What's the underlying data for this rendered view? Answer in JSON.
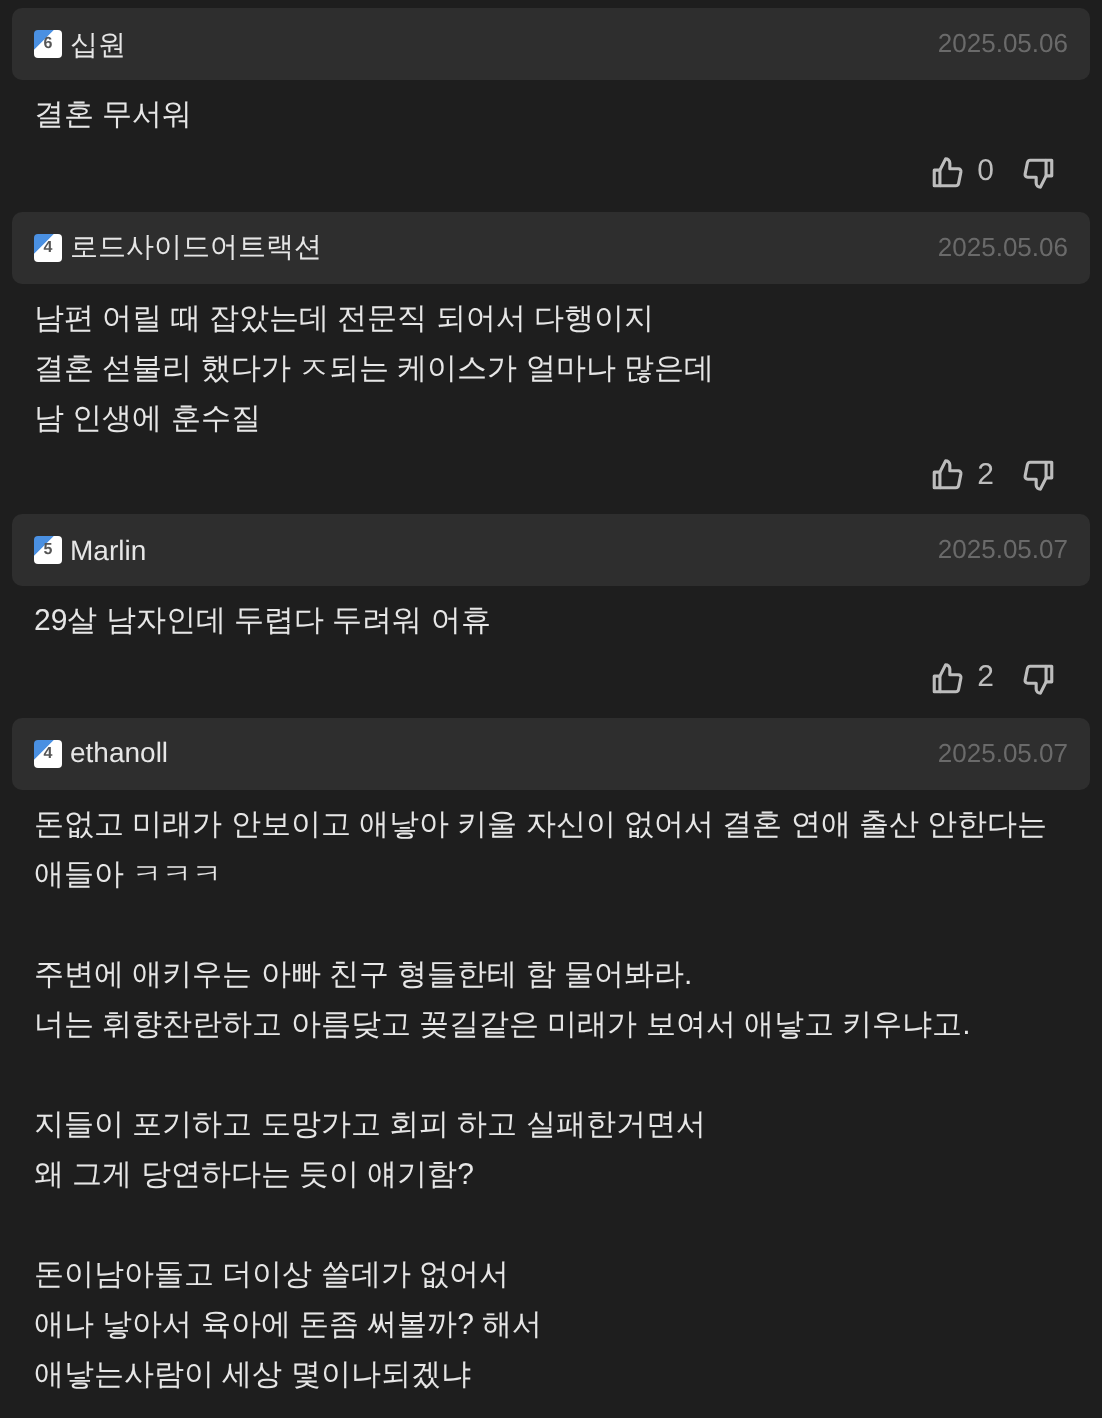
{
  "comments": [
    {
      "author": "십원",
      "badge": "6",
      "date": "2025.05.06",
      "paragraphs": [
        "결혼 무서워"
      ],
      "votes": {
        "up": "0"
      }
    },
    {
      "author": "로드사이드어트랙션",
      "badge": "4",
      "date": "2025.05.06",
      "paragraphs": [
        "남편 어릴 때 잡았는데 전문직 되어서 다행이지\n결혼 섣불리 했다가 ㅈ되는 케이스가 얼마나 많은데\n남 인생에 훈수질"
      ],
      "votes": {
        "up": "2"
      }
    },
    {
      "author": "Marlin",
      "badge": "5",
      "date": "2025.05.07",
      "paragraphs": [
        "29살 남자인데 두렵다 두려워 어휴"
      ],
      "votes": {
        "up": "2"
      }
    },
    {
      "author": "ethanoll",
      "badge": "4",
      "date": "2025.05.07",
      "paragraphs": [
        "돈없고 미래가 안보이고 애낳아 키울 자신이 없어서 결혼 연애 출산 안한다는 애들아 ㅋㅋㅋ",
        "주변에 애키우는 아빠 친구 형들한테 함 물어봐라.\n너는 휘향찬란하고 아름닺고 꽂길같은 미래가 보여서 애낳고 키우냐고.",
        "지들이 포기하고 도망가고 회피 하고 실패한거면서\n왜 그게 당연하다는 듯이 얘기함?",
        "돈이남아돌고 더이상 쓸데가 없어서\n애나 낳아서 육아에 돈좀 써볼까? 해서\n애낳는사람이 세상 몇이나되겠냐"
      ]
    }
  ]
}
